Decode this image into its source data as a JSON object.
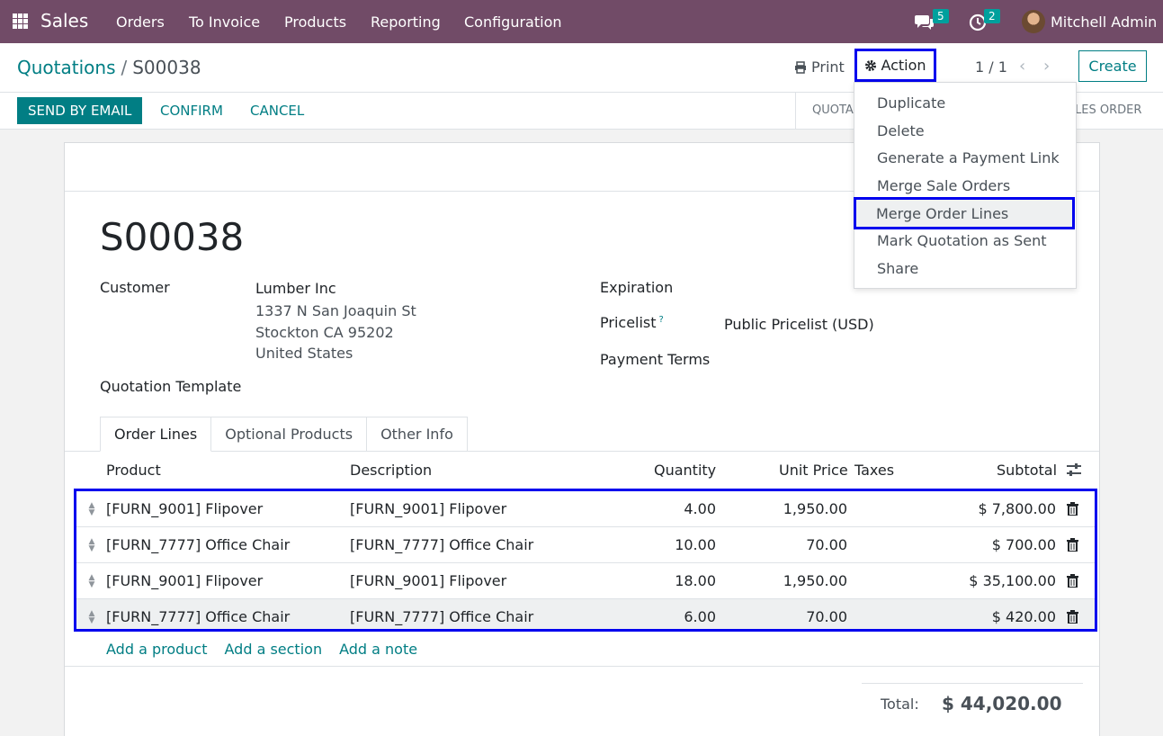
{
  "navbar": {
    "app_name": "Sales",
    "menu": [
      "Orders",
      "To Invoice",
      "Products",
      "Reporting",
      "Configuration"
    ],
    "messages_count": "5",
    "activities_count": "2",
    "user_name": "Mitchell Admin"
  },
  "control": {
    "breadcrumb_parent": "Quotations",
    "breadcrumb_separator": "/",
    "breadcrumb_current": "S00038",
    "print_label": "Print",
    "action_label": "Action",
    "pager": "1 / 1",
    "create_label": "Create"
  },
  "statusbar": {
    "send_label": "SEND BY EMAIL",
    "confirm_label": "CONFIRM",
    "cancel_label": "CANCEL",
    "stage_left": "QUOTA",
    "stage_right": "LES ORDER"
  },
  "form": {
    "title": "S00038",
    "customer_label": "Customer",
    "customer_name": "Lumber Inc",
    "address": [
      "1337 N San Joaquin St",
      "Stockton CA 95202",
      "United States"
    ],
    "template_label": "Quotation Template",
    "expiration_label": "Expiration",
    "pricelist_label": "Pricelist",
    "pricelist_help": "?",
    "pricelist_value": "Public Pricelist (USD)",
    "payment_terms_label": "Payment Terms"
  },
  "tabs": [
    "Order Lines",
    "Optional Products",
    "Other Info"
  ],
  "table": {
    "headers": {
      "product": "Product",
      "description": "Description",
      "quantity": "Quantity",
      "unit_price": "Unit Price",
      "taxes": "Taxes",
      "subtotal": "Subtotal"
    },
    "rows": [
      {
        "product": "[FURN_9001] Flipover",
        "description": "[FURN_9001] Flipover",
        "quantity": "4.00",
        "unit_price": "1,950.00",
        "subtotal": "$ 7,800.00"
      },
      {
        "product": "[FURN_7777] Office Chair",
        "description": "[FURN_7777] Office Chair",
        "quantity": "10.00",
        "unit_price": "70.00",
        "subtotal": "$ 700.00"
      },
      {
        "product": "[FURN_9001] Flipover",
        "description": "[FURN_9001] Flipover",
        "quantity": "18.00",
        "unit_price": "1,950.00",
        "subtotal": "$ 35,100.00"
      },
      {
        "product": "[FURN_7777] Office Chair",
        "description": "[FURN_7777] Office Chair",
        "quantity": "6.00",
        "unit_price": "70.00",
        "subtotal": "$ 420.00"
      }
    ],
    "add_product": "Add a product",
    "add_section": "Add a section",
    "add_note": "Add a note"
  },
  "totals": {
    "total_label": "Total:",
    "total_value": "$ 44,020.00"
  },
  "action_menu": [
    "Duplicate",
    "Delete",
    "Generate a Payment Link",
    "Merge Sale Orders",
    "Merge Order Lines",
    "Mark Quotation as Sent",
    "Share"
  ],
  "colors": {
    "navbar": "#714b67",
    "accent": "#017e84",
    "highlight_border": "#0000ee"
  }
}
